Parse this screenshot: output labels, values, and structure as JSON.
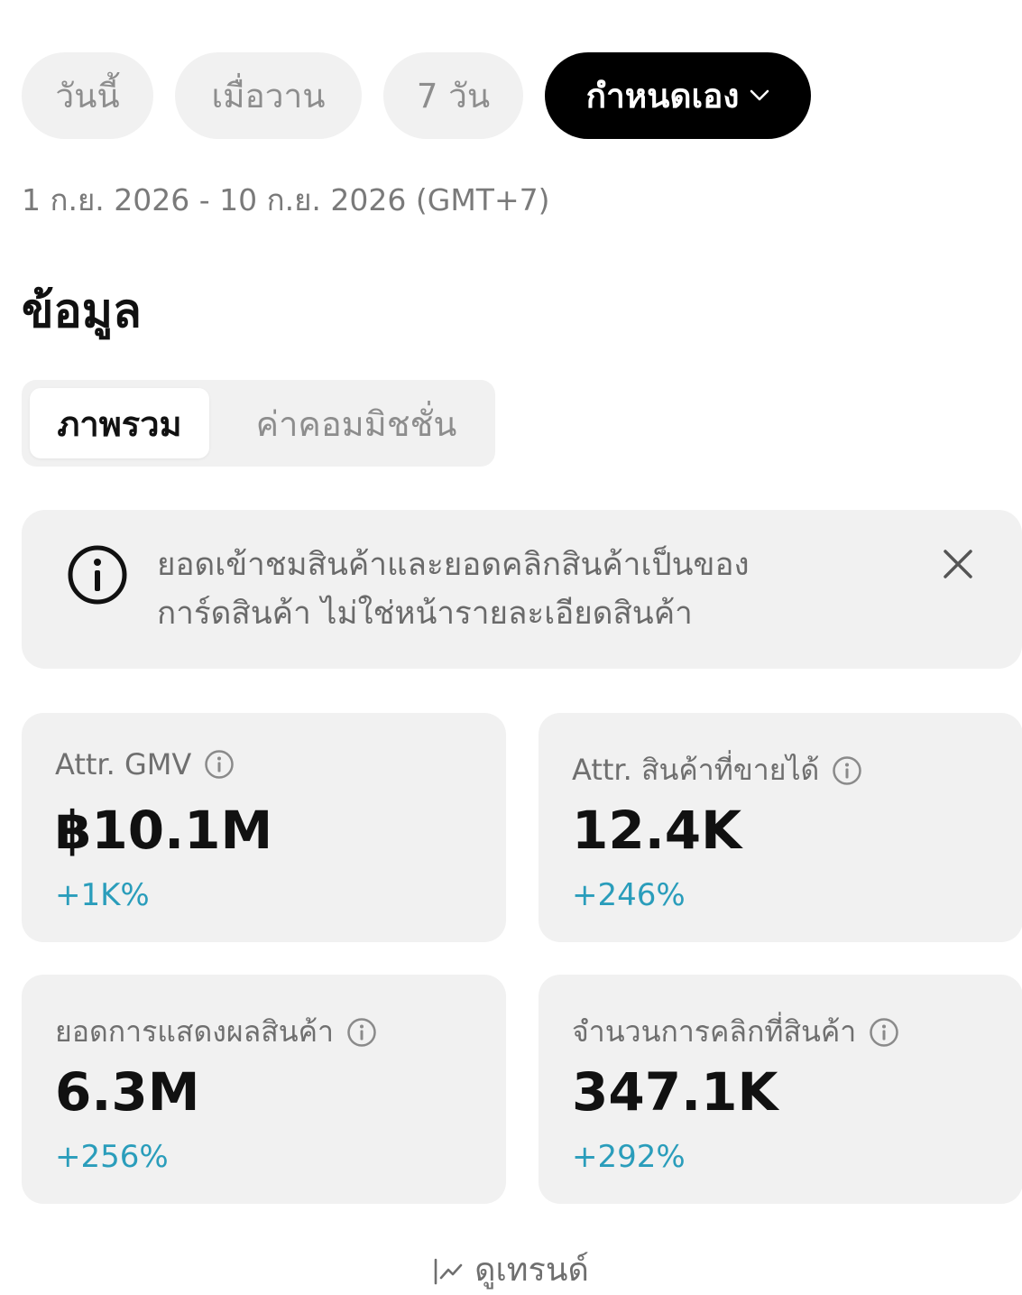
{
  "date_filters": {
    "today": "วันนี้",
    "yesterday": "เมื่อวาน",
    "seven_days": "7 วัน",
    "custom": "กำหนดเอง"
  },
  "date_range": "1 ก.ย. 2026 - 10 ก.ย. 2026 (GMT+7)",
  "section_title": "ข้อมูล",
  "tabs": {
    "overview": "ภาพรวม",
    "commission": "ค่าคอมมิชชั่น"
  },
  "notice": {
    "line1": "ยอดเข้าชมสินค้าและยอดคลิกสินค้าเป็นของ",
    "line2": "การ์ดสินค้า ไม่ใช่หน้ารายละเอียดสินค้า"
  },
  "metrics": [
    {
      "label": "Attr. GMV",
      "value": "฿10.1M",
      "change": "+1K%"
    },
    {
      "label": "Attr. สินค้าที่ขายได้",
      "value": "12.4K",
      "change": "+246%"
    },
    {
      "label": "ยอดการแสดงผลสินค้า",
      "value": "6.3M",
      "change": "+256%"
    },
    {
      "label": "จำนวนการคลิกที่สินค้า",
      "value": "347.1K",
      "change": "+292%"
    }
  ],
  "trend_link": "ดูเทรนด์",
  "colors": {
    "accent_positive": "#2a9dbb",
    "chip_active_bg": "#000000",
    "card_bg": "#f1f1f1"
  }
}
